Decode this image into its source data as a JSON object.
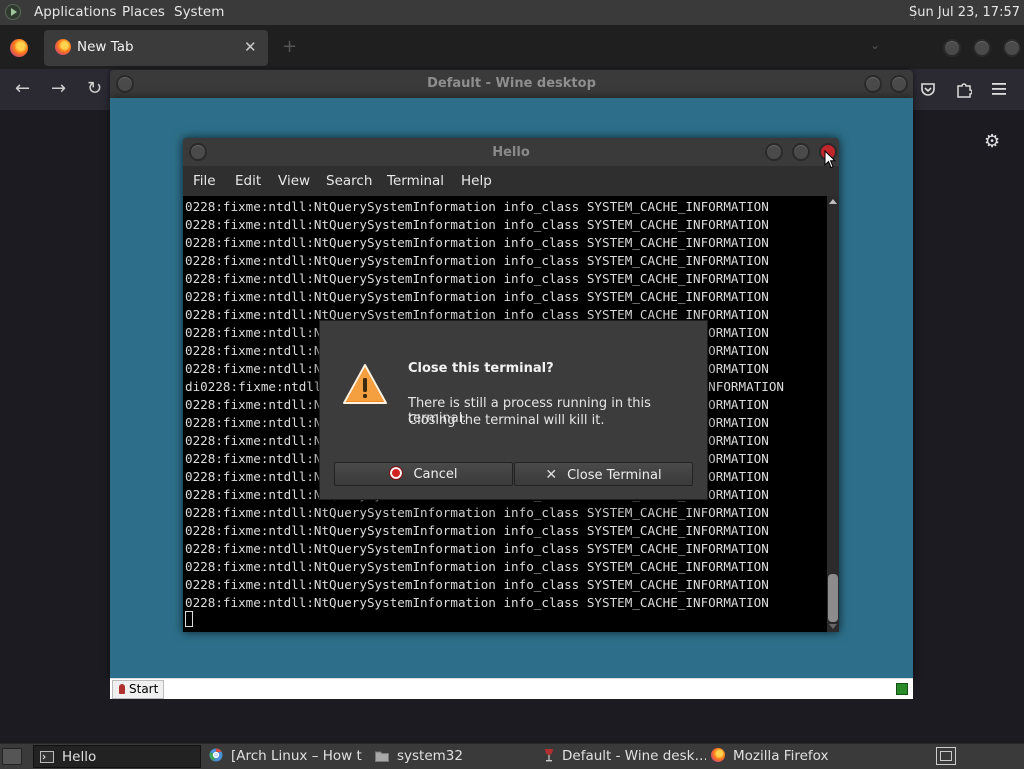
{
  "top_panel": {
    "menus": [
      "Applications",
      "Places",
      "System"
    ],
    "clock": "Sun Jul 23, 17:57"
  },
  "firefox": {
    "tab_title": "New Tab",
    "tab_close": "✕",
    "new_tab": "+",
    "nav": {
      "back": "←",
      "forward": "→",
      "reload": "↻"
    },
    "toolbar_icons": [
      "pocket-icon",
      "extensions-icon",
      "menu-icon"
    ],
    "settings_icon": "⚙"
  },
  "wine": {
    "title": "Default - Wine desktop",
    "start_label": "Start"
  },
  "terminal": {
    "title": "Hello",
    "menus": [
      "File",
      "Edit",
      "View",
      "Search",
      "Terminal",
      "Help"
    ],
    "lines": [
      "0228:fixme:ntdll:NtQuerySystemInformation info_class SYSTEM_CACHE_INFORMATION",
      "0228:fixme:ntdll:NtQuerySystemInformation info_class SYSTEM_CACHE_INFORMATION",
      "0228:fixme:ntdll:NtQuerySystemInformation info_class SYSTEM_CACHE_INFORMATION",
      "0228:fixme:ntdll:NtQuerySystemInformation info_class SYSTEM_CACHE_INFORMATION",
      "0228:fixme:ntdll:NtQuerySystemInformation info_class SYSTEM_CACHE_INFORMATION",
      "0228:fixme:ntdll:NtQuerySystemInformation info_class SYSTEM_CACHE_INFORMATION",
      "0228:fixme:ntdll:NtQuerySystemInformation info_class SYSTEM_CACHE_INFORMATION",
      "0228:fixme:ntdll:NtQuerySystemInformation info_class SYSTEM_CACHE_INFORMATION",
      "0228:fixme:ntdll:NtQuerySystemInformation info_class SYSTEM_CACHE_INFORMATION",
      "0228:fixme:ntdll:NtQuerySystemInformation info_class SYSTEM_CACHE_INFORMATION",
      "di0228:fixme:ntdll:NtQuerySystemInformation info_class SYSTEM_CACHE_INFORMATION",
      "0228:fixme:ntdll:NtQuerySystemInformation info_class SYSTEM_CACHE_INFORMATION",
      "0228:fixme:ntdll:NtQuerySystemInformation info_class SYSTEM_CACHE_INFORMATION",
      "0228:fixme:ntdll:NtQuerySystemInformation info_class SYSTEM_CACHE_INFORMATION",
      "0228:fixme:ntdll:NtQuerySystemInformation info_class SYSTEM_CACHE_INFORMATION",
      "0228:fixme:ntdll:NtQuerySystemInformation info_class SYSTEM_CACHE_INFORMATION",
      "0228:fixme:ntdll:NtQuerySystemInformation info_class SYSTEM_CACHE_INFORMATION",
      "0228:fixme:ntdll:NtQuerySystemInformation info_class SYSTEM_CACHE_INFORMATION",
      "0228:fixme:ntdll:NtQuerySystemInformation info_class SYSTEM_CACHE_INFORMATION",
      "0228:fixme:ntdll:NtQuerySystemInformation info_class SYSTEM_CACHE_INFORMATION",
      "0228:fixme:ntdll:NtQuerySystemInformation info_class SYSTEM_CACHE_INFORMATION",
      "0228:fixme:ntdll:NtQuerySystemInformation info_class SYSTEM_CACHE_INFORMATION",
      "0228:fixme:ntdll:NtQuerySystemInformation info_class SYSTEM_CACHE_INFORMATION"
    ]
  },
  "dialog": {
    "title": "Close this terminal?",
    "message_line1": "There is still a process running in this terminal.",
    "message_line2": "Closing the terminal will kill it.",
    "cancel_label": "Cancel",
    "close_label": "Close Terminal"
  },
  "taskbar": {
    "items": [
      {
        "label": "Hello",
        "icon": "terminal-icon",
        "active": true
      },
      {
        "label": "[Arch Linux – How t…",
        "icon": "chromium-icon",
        "active": false
      },
      {
        "label": "system32",
        "icon": "folder-icon",
        "active": false
      },
      {
        "label": "Default - Wine desk…",
        "icon": "wine-icon",
        "active": false
      },
      {
        "label": "Mozilla Firefox",
        "icon": "firefox-icon",
        "active": false
      }
    ]
  },
  "colors": {
    "wine_desktop": "#2d6f8a",
    "terminal_bg": "#000000",
    "close_button": "#c0262a",
    "warning": "#f08a24"
  }
}
